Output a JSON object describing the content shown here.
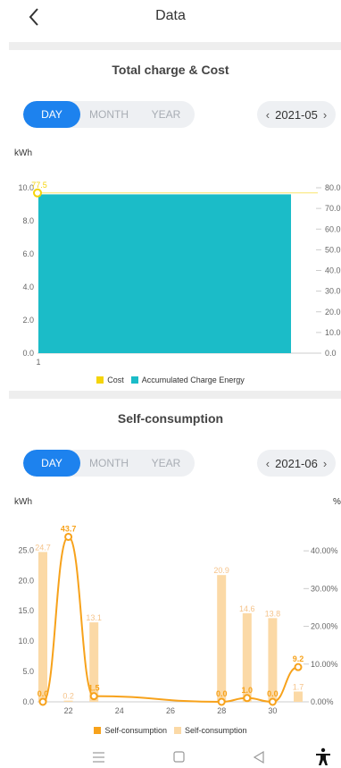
{
  "header": {
    "title": "Data"
  },
  "section1": {
    "title": "Total charge & Cost",
    "tabs": [
      "DAY",
      "MONTH",
      "YEAR"
    ],
    "active_tab": 0,
    "date": "2021-05",
    "unit_left": "kWh",
    "legend": [
      {
        "label": "Cost",
        "color": "#f5d40a"
      },
      {
        "label": "Accumulated Charge Energy",
        "color": "#1bbcc8"
      }
    ]
  },
  "section2": {
    "title": "Self-consumption",
    "tabs": [
      "DAY",
      "MONTH",
      "YEAR"
    ],
    "active_tab": 0,
    "date": "2021-06",
    "unit_left": "kWh",
    "unit_right": "%",
    "legend": [
      {
        "label": "Self-consumption",
        "color": "#f7a21b"
      },
      {
        "label": "Self-consumption",
        "color": "#fbd9a6"
      }
    ]
  },
  "chart_data": [
    {
      "type": "bar",
      "categories": [
        "1"
      ],
      "series": [
        {
          "name": "Accumulated Charge Energy",
          "values": [
            9.6
          ],
          "color": "#1bbcc8"
        },
        {
          "name": "Cost",
          "values": [
            77.5
          ],
          "color": "#f5d40a",
          "axis": "right",
          "point_label": "77.5"
        }
      ],
      "ylim": [
        0,
        10
      ],
      "y2lim": [
        0,
        80
      ],
      "yticks": [
        "0.0",
        "2.0",
        "4.0",
        "6.0",
        "8.0",
        "10.0"
      ],
      "y2ticks": [
        "0.0",
        "10.0",
        "20.0",
        "30.0",
        "40.0",
        "50.0",
        "60.0",
        "70.0",
        "80.0"
      ],
      "xticks": [
        "1"
      ],
      "ylabel": "kWh"
    },
    {
      "type": "bar",
      "x": [
        21,
        22,
        23,
        24,
        25,
        26,
        27,
        28,
        29,
        30,
        31
      ],
      "xticks": [
        "22",
        "24",
        "26",
        "28",
        "30"
      ],
      "series": [
        {
          "name": "Self-consumption",
          "type": "bar",
          "values": [
            24.7,
            0.2,
            13.1,
            0,
            0,
            0,
            0,
            20.9,
            14.6,
            13.8,
            1.7
          ],
          "labels": [
            "24.7",
            "0.2",
            "13.1",
            "",
            "",
            "",
            "",
            "20.9",
            "14.6",
            "13.8",
            "1.7"
          ],
          "color": "#fbd9a6"
        },
        {
          "name": "Self-consumption",
          "type": "line",
          "axis": "right",
          "points": [
            [
              21,
              0.0
            ],
            [
              22,
              43.7
            ],
            [
              23,
              1.5
            ],
            [
              28,
              0.0
            ],
            [
              29,
              1.0
            ],
            [
              30,
              0.0
            ],
            [
              31,
              9.2
            ]
          ],
          "labels": [
            "0.0",
            "43.7",
            "1.5",
            "0.0",
            "1.0",
            "0.0",
            "9.2"
          ],
          "color": "#f7a21b"
        }
      ],
      "ylim": [
        0,
        28
      ],
      "y2lim": [
        0,
        45
      ],
      "yticks": [
        "0.0",
        "5.0",
        "10.0",
        "15.0",
        "20.0",
        "25.0"
      ],
      "y2ticks": [
        "0.00%",
        "10.00%",
        "20.00%",
        "30.00%",
        "40.00%"
      ],
      "ylabel": "kWh",
      "y2label": "%"
    }
  ]
}
